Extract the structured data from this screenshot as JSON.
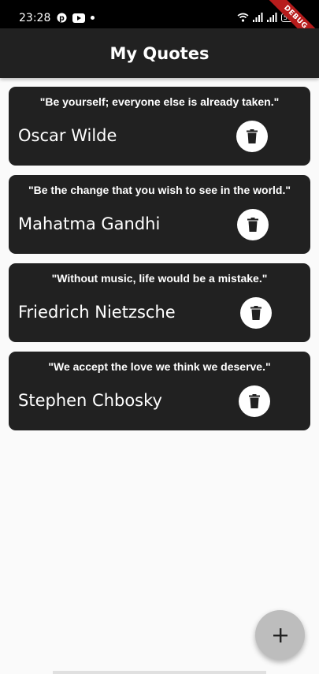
{
  "status_bar": {
    "time": "23:28",
    "left_icons": [
      "pinterest-icon",
      "youtube-icon",
      "dot"
    ],
    "right_icons": [
      "wifi-icon",
      "signal-icon",
      "signal-icon",
      "battery-icon"
    ],
    "battery": "50"
  },
  "debug_banner": "DEBUG",
  "app_bar": {
    "title": "My Quotes",
    "background": "#212121"
  },
  "quotes": [
    {
      "text": "\"Be yourself; everyone else is already taken.\"",
      "author": "Oscar Wilde"
    },
    {
      "text": "\"Be the change that you wish to see in the world.\"",
      "author": "Mahatma Gandhi"
    },
    {
      "text": "\"Without music, life would be a mistake.\"",
      "author": "Friedrich Nietzsche"
    },
    {
      "text": "\"We accept the love we think we deserve.\"",
      "author": "Stephen Chbosky"
    }
  ],
  "fab": {
    "icon": "plus-icon",
    "label": "+"
  },
  "colors": {
    "card": "#212121",
    "background": "#fafafa",
    "fab": "#bdbdbd",
    "debug": "#b71c1c"
  }
}
